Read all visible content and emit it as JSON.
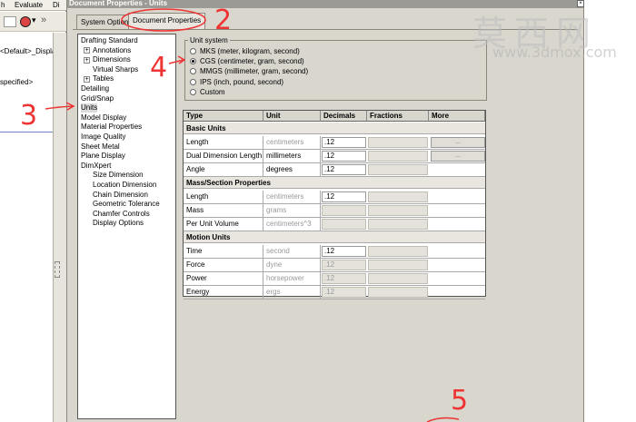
{
  "background_app": {
    "menu": [
      "h",
      "Evaluate",
      "Di"
    ],
    "tree_lines": [
      "<Default>_Display",
      "specified>"
    ]
  },
  "dialog": {
    "title": "Document Properties - Units",
    "close_label": "×",
    "tabs": [
      {
        "label": "System Options",
        "active": false
      },
      {
        "label": "Document Properties",
        "active": true
      }
    ]
  },
  "nav_tree": [
    {
      "label": "Drafting Standard",
      "level": 0,
      "expander": ""
    },
    {
      "label": "Annotations",
      "level": 1,
      "expander": "+"
    },
    {
      "label": "Dimensions",
      "level": 1,
      "expander": "+"
    },
    {
      "label": "Virtual Sharps",
      "level": 1,
      "expander": ""
    },
    {
      "label": "Tables",
      "level": 1,
      "expander": "+"
    },
    {
      "label": "Detailing",
      "level": 0,
      "expander": ""
    },
    {
      "label": "Grid/Snap",
      "level": 0,
      "expander": ""
    },
    {
      "label": "Units",
      "level": 0,
      "expander": "",
      "selected": true
    },
    {
      "label": "Model Display",
      "level": 0,
      "expander": ""
    },
    {
      "label": "Material Properties",
      "level": 0,
      "expander": ""
    },
    {
      "label": "Image Quality",
      "level": 0,
      "expander": ""
    },
    {
      "label": "Sheet Metal",
      "level": 0,
      "expander": ""
    },
    {
      "label": "Plane Display",
      "level": 0,
      "expander": ""
    },
    {
      "label": "DimXpert",
      "level": 0,
      "expander": ""
    },
    {
      "label": "Size Dimension",
      "level": 1,
      "expander": ""
    },
    {
      "label": "Location Dimension",
      "level": 1,
      "expander": ""
    },
    {
      "label": "Chain Dimension",
      "level": 1,
      "expander": ""
    },
    {
      "label": "Geometric Tolerance",
      "level": 1,
      "expander": ""
    },
    {
      "label": "Chamfer Controls",
      "level": 1,
      "expander": ""
    },
    {
      "label": "Display Options",
      "level": 1,
      "expander": ""
    }
  ],
  "unit_system": {
    "legend": "Unit system",
    "options": [
      {
        "label": "MKS  (meter, kilogram, second)",
        "checked": false
      },
      {
        "label": "CGS  (centimeter, gram, second)",
        "checked": true
      },
      {
        "label": "MMGS  (millimeter, gram, second)",
        "checked": false
      },
      {
        "label": "IPS  (inch, pound, second)",
        "checked": false
      },
      {
        "label": "Custom",
        "checked": false
      }
    ]
  },
  "units_table": {
    "headers": [
      "Type",
      "Unit",
      "Decimals",
      "Fractions",
      "More"
    ],
    "more_label": "...",
    "sections": [
      {
        "title": "Basic Units",
        "rows": [
          {
            "type": "Length",
            "unit": "centimeters",
            "unit_gray": true,
            "decimals": ".12",
            "dec_enabled": true,
            "more": true
          },
          {
            "type": "Dual Dimension Length",
            "unit": "millimeters",
            "unit_gray": false,
            "decimals": ".12",
            "dec_enabled": true,
            "more": true
          },
          {
            "type": "Angle",
            "unit": "degrees",
            "unit_gray": false,
            "decimals": ".12",
            "dec_enabled": true,
            "more": false
          }
        ]
      },
      {
        "title": "Mass/Section Properties",
        "rows": [
          {
            "type": "Length",
            "unit": "centimeters",
            "unit_gray": true,
            "decimals": ".12",
            "dec_enabled": true,
            "more": false
          },
          {
            "type": "Mass",
            "unit": "grams",
            "unit_gray": true,
            "decimals": "",
            "dec_enabled": false,
            "more": false
          },
          {
            "type": "Per Unit Volume",
            "unit": "centimeters^3",
            "unit_gray": true,
            "decimals": "",
            "dec_enabled": false,
            "more": false
          }
        ]
      },
      {
        "title": "Motion Units",
        "rows": [
          {
            "type": "Time",
            "unit": "second",
            "unit_gray": true,
            "decimals": ".12",
            "dec_enabled": true,
            "more": false
          },
          {
            "type": "Force",
            "unit": "dyne",
            "unit_gray": true,
            "decimals": ".12",
            "dec_enabled": false,
            "more": false
          },
          {
            "type": "Power",
            "unit": "horsepower",
            "unit_gray": true,
            "decimals": ".12",
            "dec_enabled": false,
            "more": false
          },
          {
            "type": "Energy",
            "unit": "ergs",
            "unit_gray": true,
            "decimals": ".12",
            "dec_enabled": false,
            "more": false
          }
        ]
      }
    ]
  },
  "watermark": {
    "text_cn": "莫西网",
    "url": "www.3dmox.com"
  },
  "annotations": [
    "2",
    "3",
    "4",
    "5"
  ],
  "colors": {
    "annotation_red": "#e33333",
    "dialog_bg": "#d9d6ce"
  }
}
